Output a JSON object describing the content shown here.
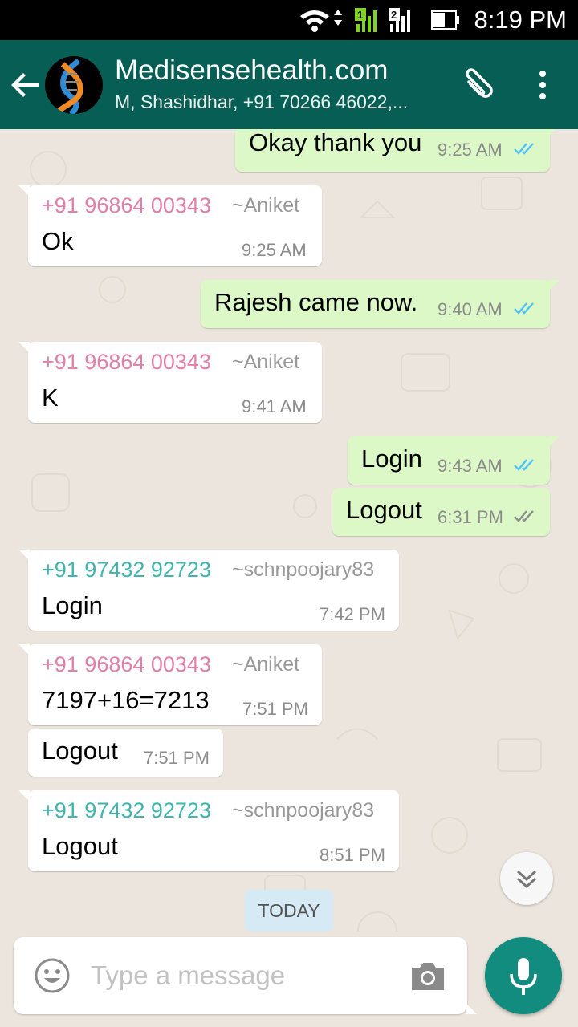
{
  "status_bar": {
    "time": "8:19 PM",
    "sim1_label": "1",
    "sim2_label": "2"
  },
  "header": {
    "title": "Medisensehealth.com",
    "subtitle": "M, Shashidhar, +91 70266 46022,..."
  },
  "messages": [
    {
      "dir": "out",
      "text": "Okay thank you",
      "time": "9:25 AM",
      "ticks": "read"
    },
    {
      "dir": "in",
      "sender": "+91 96864 00343",
      "alias": "~Aniket",
      "text": "Ok",
      "time": "9:25 AM"
    },
    {
      "dir": "out",
      "text": "Rajesh came now.",
      "time": "9:40 AM",
      "ticks": "read"
    },
    {
      "dir": "in",
      "sender": "+91 96864 00343",
      "alias": "~Aniket",
      "text": "K",
      "time": "9:41 AM"
    },
    {
      "dir": "out",
      "text": "Login",
      "time": "9:43 AM",
      "ticks": "read"
    },
    {
      "dir": "out",
      "text": "Logout",
      "time": "6:31 PM",
      "ticks": "delivered"
    },
    {
      "dir": "in",
      "sender": "+91 97432 92723",
      "alias": "~schnpoojary83",
      "text": "Login",
      "time": "7:42 PM"
    },
    {
      "dir": "in",
      "sender": "+91 96864 00343",
      "alias": "~Aniket",
      "text": "7197+16=7213",
      "time": "7:51 PM"
    },
    {
      "dir": "in",
      "text": "Logout",
      "time": "7:51 PM"
    },
    {
      "dir": "in",
      "sender": "+91 97432 92723",
      "alias": "~schnpoojary83",
      "text": "Logout",
      "time": "8:51 PM"
    }
  ],
  "date_divider": "TODAY",
  "composer": {
    "placeholder": "Type a message"
  },
  "icons": {
    "back": "arrow-left-icon",
    "avatar": "dna-helix-logo",
    "attach": "paperclip-icon",
    "menu": "more-vert-icon",
    "scroll": "chevron-double-down-icon",
    "emoji": "smiley-icon",
    "camera": "camera-icon",
    "mic": "mic-icon"
  },
  "colors": {
    "header": "#075e54",
    "outgoing_bubble": "#dcf8c6",
    "incoming_bubble": "#ffffff",
    "sender_pink": "#e27fa8",
    "sender_teal": "#3fb6ad",
    "read_ticks": "#4fc3f7",
    "fab": "#128c7e"
  }
}
